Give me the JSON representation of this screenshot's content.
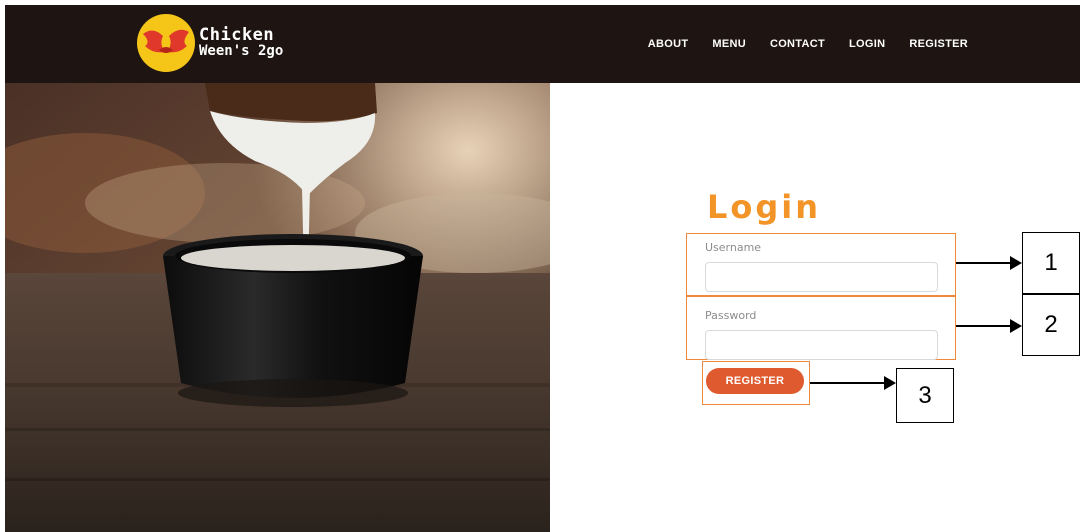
{
  "brand": {
    "line1": "Chicken",
    "line2": "Ween's 2go",
    "badge_color": "#f5c518",
    "emblem_color": "#e0392b"
  },
  "nav": {
    "items": [
      {
        "label": "ABOUT"
      },
      {
        "label": "MENU"
      },
      {
        "label": "CONTACT"
      },
      {
        "label": "LOGIN"
      },
      {
        "label": "REGISTER"
      }
    ],
    "background": "#1e1512"
  },
  "login": {
    "title": "Login",
    "title_color": "#f29427",
    "username_label": "Username",
    "username_value": "",
    "password_label": "Password",
    "password_value": "",
    "submit_label": "REGISTER",
    "submit_color": "#df5a2e"
  },
  "annotations": {
    "highlight_color": "#ef8a3c",
    "callouts": [
      {
        "number": "1"
      },
      {
        "number": "2"
      },
      {
        "number": "3"
      }
    ]
  }
}
